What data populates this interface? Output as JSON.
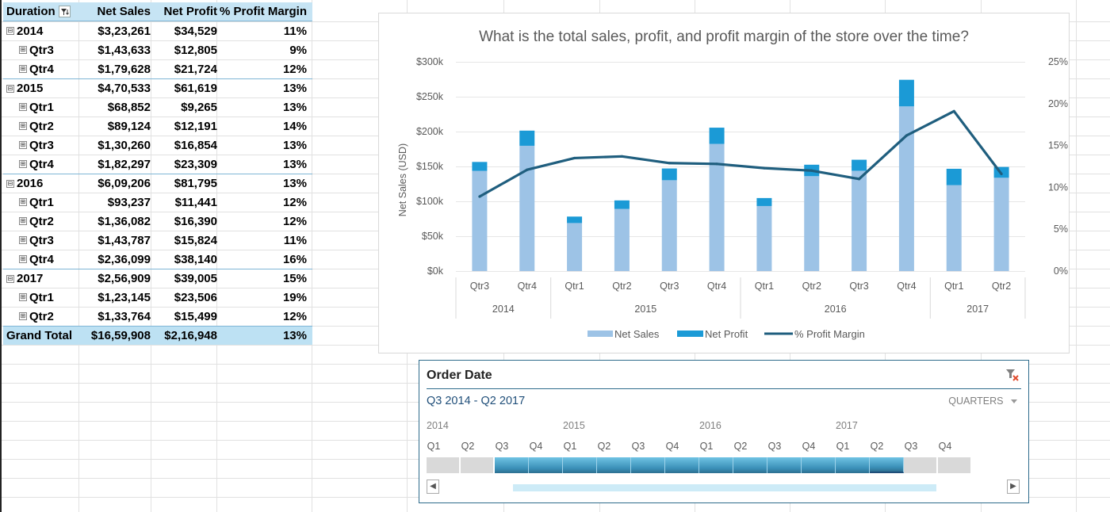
{
  "pivot": {
    "headers": {
      "duration": "Duration",
      "net_sales": "Net Sales",
      "net_profit": "Net Profit",
      "margin": "% Profit Margin"
    },
    "rows": [
      {
        "label": "2014",
        "level": "year",
        "expander": "⊟",
        "net_sales": "$3,23,261",
        "net_profit": "$34,529",
        "margin": "11%"
      },
      {
        "label": "Qtr3",
        "level": "qtr",
        "expander": "⊞",
        "net_sales": "$1,43,633",
        "net_profit": "$12,805",
        "margin": "9%"
      },
      {
        "label": "Qtr4",
        "level": "qtr",
        "expander": "⊞",
        "net_sales": "$1,79,628",
        "net_profit": "$21,724",
        "margin": "12%"
      },
      {
        "label": "2015",
        "level": "year",
        "expander": "⊟",
        "net_sales": "$4,70,533",
        "net_profit": "$61,619",
        "margin": "13%"
      },
      {
        "label": "Qtr1",
        "level": "qtr",
        "expander": "⊞",
        "net_sales": "$68,852",
        "net_profit": "$9,265",
        "margin": "13%"
      },
      {
        "label": "Qtr2",
        "level": "qtr",
        "expander": "⊞",
        "net_sales": "$89,124",
        "net_profit": "$12,191",
        "margin": "14%"
      },
      {
        "label": "Qtr3",
        "level": "qtr",
        "expander": "⊞",
        "net_sales": "$1,30,260",
        "net_profit": "$16,854",
        "margin": "13%"
      },
      {
        "label": "Qtr4",
        "level": "qtr",
        "expander": "⊞",
        "net_sales": "$1,82,297",
        "net_profit": "$23,309",
        "margin": "13%"
      },
      {
        "label": "2016",
        "level": "year",
        "expander": "⊟",
        "net_sales": "$6,09,206",
        "net_profit": "$81,795",
        "margin": "13%"
      },
      {
        "label": "Qtr1",
        "level": "qtr",
        "expander": "⊞",
        "net_sales": "$93,237",
        "net_profit": "$11,441",
        "margin": "12%"
      },
      {
        "label": "Qtr2",
        "level": "qtr",
        "expander": "⊞",
        "net_sales": "$1,36,082",
        "net_profit": "$16,390",
        "margin": "12%"
      },
      {
        "label": "Qtr3",
        "level": "qtr",
        "expander": "⊞",
        "net_sales": "$1,43,787",
        "net_profit": "$15,824",
        "margin": "11%"
      },
      {
        "label": "Qtr4",
        "level": "qtr",
        "expander": "⊞",
        "net_sales": "$2,36,099",
        "net_profit": "$38,140",
        "margin": "16%"
      },
      {
        "label": "2017",
        "level": "year",
        "expander": "⊟",
        "net_sales": "$2,56,909",
        "net_profit": "$39,005",
        "margin": "15%"
      },
      {
        "label": "Qtr1",
        "level": "qtr",
        "expander": "⊞",
        "net_sales": "$1,23,145",
        "net_profit": "$23,506",
        "margin": "19%"
      },
      {
        "label": "Qtr2",
        "level": "qtr",
        "expander": "⊞",
        "net_sales": "$1,33,764",
        "net_profit": "$15,499",
        "margin": "12%"
      }
    ],
    "total": {
      "label": "Grand Total",
      "net_sales": "$16,59,908",
      "net_profit": "$2,16,948",
      "margin": "13%"
    }
  },
  "chart_data": {
    "type": "bar",
    "stacked": true,
    "secondary_line": true,
    "title": "What is the total sales, profit, and profit margin of the store over the time?",
    "ylabel": "Net Sales (USD)",
    "ylim": [
      0,
      300000
    ],
    "y_ticks": [
      "$0k",
      "$50k",
      "$100k",
      "$150k",
      "$200k",
      "$250k",
      "$300k"
    ],
    "y2lim": [
      0,
      25
    ],
    "y2_ticks": [
      "0%",
      "5%",
      "10%",
      "15%",
      "20%",
      "25%"
    ],
    "categories": [
      "Qtr3",
      "Qtr4",
      "Qtr1",
      "Qtr2",
      "Qtr3",
      "Qtr4",
      "Qtr1",
      "Qtr2",
      "Qtr3",
      "Qtr4",
      "Qtr1",
      "Qtr2"
    ],
    "groups": [
      {
        "label": "2014",
        "count": 2
      },
      {
        "label": "2015",
        "count": 4
      },
      {
        "label": "2016",
        "count": 4
      },
      {
        "label": "2017",
        "count": 2
      }
    ],
    "series": [
      {
        "name": "Net Sales",
        "kind": "bar",
        "color": "#9dc3e6",
        "values": [
          143633,
          179628,
          68852,
          89124,
          130260,
          182297,
          93237,
          136082,
          143787,
          236099,
          123145,
          133764
        ]
      },
      {
        "name": "Net Profit",
        "kind": "bar",
        "color": "#1b9ad6",
        "values": [
          12805,
          21724,
          9265,
          12191,
          16854,
          23309,
          11441,
          16390,
          15824,
          38140,
          23506,
          15499
        ]
      },
      {
        "name": "% Profit Margin",
        "kind": "line",
        "axis": "secondary",
        "color": "#1f5e7e",
        "values": [
          8.9,
          12.1,
          13.5,
          13.7,
          12.9,
          12.8,
          12.3,
          12.0,
          11.0,
          16.2,
          19.1,
          11.6
        ]
      }
    ],
    "legend_position": "bottom",
    "grid": true
  },
  "timeline": {
    "title": "Order Date",
    "range_label": "Q3 2014 - Q2 2017",
    "level_label": "QUARTERS",
    "level_icon": "dropdown-arrow-icon",
    "clear_icon": "clear-filter-icon",
    "years": [
      "2014",
      "2015",
      "2016",
      "2017"
    ],
    "quarters": [
      "Q1",
      "Q2",
      "Q3",
      "Q4",
      "Q1",
      "Q2",
      "Q3",
      "Q4",
      "Q1",
      "Q2",
      "Q3",
      "Q4",
      "Q1",
      "Q2",
      "Q3",
      "Q4"
    ],
    "selected_from": 2,
    "selected_to": 13,
    "left_arrow": "◀",
    "right_arrow": "▶"
  }
}
